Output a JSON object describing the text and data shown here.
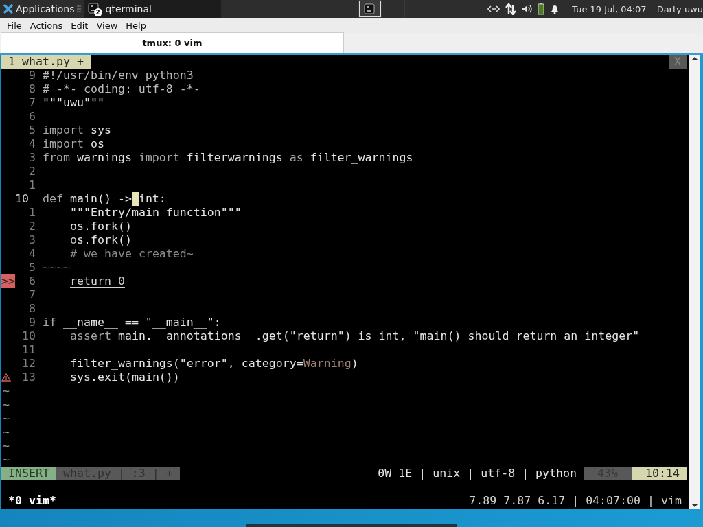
{
  "top_panel": {
    "menu_label": "Applications",
    "task": {
      "title": "qterminal",
      "badge": "2"
    },
    "clock": "Tue 19 Jul, 04:07",
    "user": "Darty uwu"
  },
  "menu_bar": [
    "File",
    "Actions",
    "Edit",
    "View",
    "Help"
  ],
  "tabs": [
    {
      "label": "tmux: 0 vim",
      "selected": true
    }
  ],
  "vim": {
    "buffer_tab": "1 what.py +",
    "close_label": "X",
    "lines": [
      {
        "number": "9",
        "segments": [
          {
            "text": "#!/usr/bin/env python3",
            "kind": "comment"
          }
        ]
      },
      {
        "number": "8",
        "segments": [
          {
            "text": "# -*- coding: utf-8 -*-",
            "kind": "comment"
          }
        ]
      },
      {
        "number": "7",
        "segments": [
          {
            "text": "\"\"\"uwu\"\"\"",
            "kind": "doc"
          }
        ]
      },
      {
        "number": "6"
      },
      {
        "number": "5",
        "segments": [
          {
            "text": "import",
            "kind": "keyword"
          },
          {
            "text": " sys",
            "kind": "plain"
          }
        ]
      },
      {
        "number": "4",
        "segments": [
          {
            "text": "import",
            "kind": "keyword"
          },
          {
            "text": " os",
            "kind": "plain"
          }
        ]
      },
      {
        "number": "3",
        "segments": [
          {
            "text": "from",
            "kind": "keyword"
          },
          {
            "text": " warnings ",
            "kind": "plain"
          },
          {
            "text": "import",
            "kind": "keyword"
          },
          {
            "text": " filterwarnings ",
            "kind": "plain"
          },
          {
            "text": "as",
            "kind": "keyword"
          },
          {
            "text": " filter_warnings",
            "kind": "plain"
          }
        ]
      },
      {
        "number": "2"
      },
      {
        "number": "1"
      },
      {
        "number": "10",
        "current": true,
        "segments": [
          {
            "text": "def",
            "kind": "keyword"
          },
          {
            "text": " main() ->",
            "kind": "plain"
          },
          {
            "text": "int:",
            "kind": "plain",
            "cursor_before": true
          }
        ]
      },
      {
        "number": "1",
        "indented": true,
        "segments": [
          {
            "text": "\"\"\"Entry/main function\"\"\"",
            "kind": "doc"
          }
        ]
      },
      {
        "number": "2",
        "indented": true,
        "segments": [
          {
            "text": "os.fork()",
            "kind": "plain"
          }
        ]
      },
      {
        "number": "3",
        "indented": true,
        "segments": [
          {
            "text": "o",
            "kind": "underline"
          },
          {
            "text": "s.fork()",
            "kind": "plain"
          }
        ]
      },
      {
        "number": "4",
        "indented": true,
        "segments": [
          {
            "text": "# we have created~",
            "kind": "dim"
          }
        ]
      },
      {
        "number": "5",
        "segments": [
          {
            "text": "~~~~",
            "kind": "faint"
          }
        ]
      },
      {
        "number": "6",
        "indented": true,
        "sign": {
          "kind": "error",
          "text": ">>"
        },
        "segments": [
          {
            "text": "return 0",
            "kind": "underline"
          }
        ]
      },
      {
        "number": "7"
      },
      {
        "number": "8"
      },
      {
        "number": "9",
        "segments": [
          {
            "text": "if",
            "kind": "keyword"
          },
          {
            "text": " __name__ == ",
            "kind": "plain"
          },
          {
            "text": "\"__main__\"",
            "kind": "string"
          },
          {
            "text": ":",
            "kind": "plain"
          }
        ]
      },
      {
        "number": "10",
        "indented": true,
        "segments": [
          {
            "text": "assert",
            "kind": "keyword"
          },
          {
            "text": " main.__annotations__.get(",
            "kind": "plain"
          },
          {
            "text": "\"return\"",
            "kind": "string"
          },
          {
            "text": ") is ",
            "kind": "plain"
          },
          {
            "text": "int",
            "kind": "plain"
          },
          {
            "text": ", ",
            "kind": "plain"
          },
          {
            "text": "\"main() should return an integer\"",
            "kind": "string"
          }
        ]
      },
      {
        "number": "11"
      },
      {
        "number": "12",
        "indented": true,
        "segments": [
          {
            "text": "filter_warnings(",
            "kind": "plain"
          },
          {
            "text": "\"error\"",
            "kind": "string"
          },
          {
            "text": ", category=",
            "kind": "plain"
          },
          {
            "text": "Warning",
            "kind": "type"
          },
          {
            "text": ")",
            "kind": "plain"
          }
        ]
      },
      {
        "number": "13",
        "indented": true,
        "sign": {
          "kind": "warning"
        },
        "segments": [
          {
            "text": "sys.exit(main())",
            "kind": "plain"
          }
        ]
      }
    ],
    "filler": [
      "~",
      "~",
      "~",
      "~",
      "~",
      "~"
    ],
    "statusline": {
      "mode": "INSERT",
      "file_info": "what.py | :3 | +",
      "info": "0W 1E | unix | utf-8 | python",
      "percent": "43%",
      "position": "10:14"
    }
  },
  "tmux_status": {
    "window": "*0 vim*",
    "right": "7.89 7.87 6.17 | 04:07:00 | vim"
  }
}
